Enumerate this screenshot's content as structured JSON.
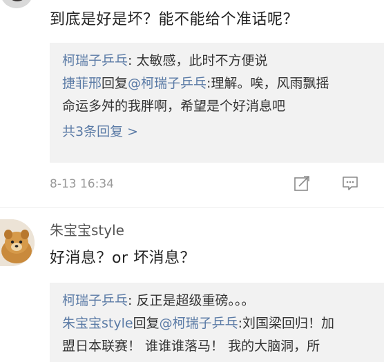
{
  "comment1": {
    "text": "到底是好是坏？能不能给个准话呢？",
    "replies": [
      {
        "name": "柯瑞子乒乓",
        "text": ": 太敏感，此时不方便说"
      },
      {
        "name": "捷菲邢",
        "mid": "回复",
        "target": "@柯瑞子乒乓",
        "text": ":理解。唉，风雨飘摇"
      },
      {
        "text": "命运多舛的我胖啊，希望是个好消息吧"
      }
    ],
    "more": "共3条回复 >",
    "timestamp": "8-13 16:34"
  },
  "comment2": {
    "username": "朱宝宝style",
    "text": "好消息？or 坏消息？",
    "replies": [
      {
        "name": "柯瑞子乒乓",
        "text": ": 反正是超级重磅。。。"
      },
      {
        "name": "朱宝宝style",
        "mid": "回复",
        "target": "@柯瑞子乒乓",
        "text": ":刘国梁回归！加"
      },
      {
        "text": "盟日本联赛！ 谁谁谁落马！ 我的大脑洞，所"
      }
    ]
  },
  "colors": {
    "link": "#5b7ba6",
    "muted": "#9a9a9a",
    "reply_bg": "#f2f2f2"
  },
  "icons": [
    "share-icon",
    "comment-icon"
  ]
}
